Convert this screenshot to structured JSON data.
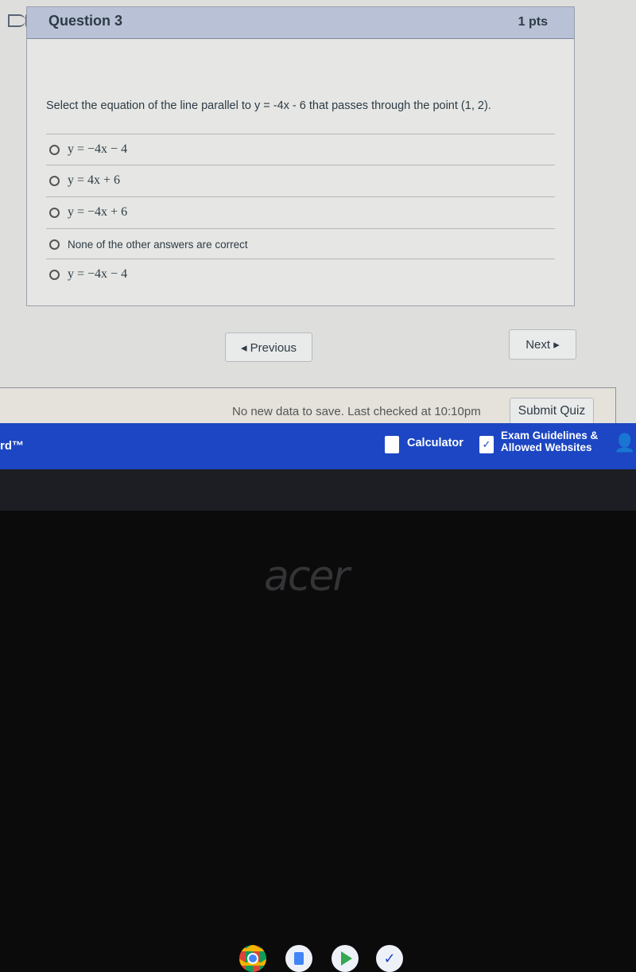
{
  "question": {
    "title": "Question 3",
    "points": "1 pts",
    "text": "Select the equation of the line parallel to y = -4x - 6 that passes through the point (1, 2).",
    "options": [
      {
        "label": "y = −4x − 4",
        "math": true
      },
      {
        "label": "y = 4x + 6",
        "math": true
      },
      {
        "label": "y = −4x + 6",
        "math": true
      },
      {
        "label": "None of the other answers are correct",
        "math": false
      },
      {
        "label": "y = −4x − 4",
        "math": true
      }
    ]
  },
  "nav": {
    "previous": "◂ Previous",
    "next": "Next ▸"
  },
  "footer": {
    "status": "No new data to save. Last checked at 10:10pm",
    "submit": "Submit Quiz"
  },
  "toolbar": {
    "brand_fragment": "rd™",
    "calculator": "Calculator",
    "guidelines_line1": "Exam Guidelines &",
    "guidelines_line2": "Allowed Websites",
    "accent": "#1c46c3"
  },
  "shelf": {
    "apps": [
      "chrome-icon",
      "docs-icon",
      "play-store-icon",
      "shield-check-icon"
    ]
  },
  "bezel": {
    "logo": "acer"
  }
}
